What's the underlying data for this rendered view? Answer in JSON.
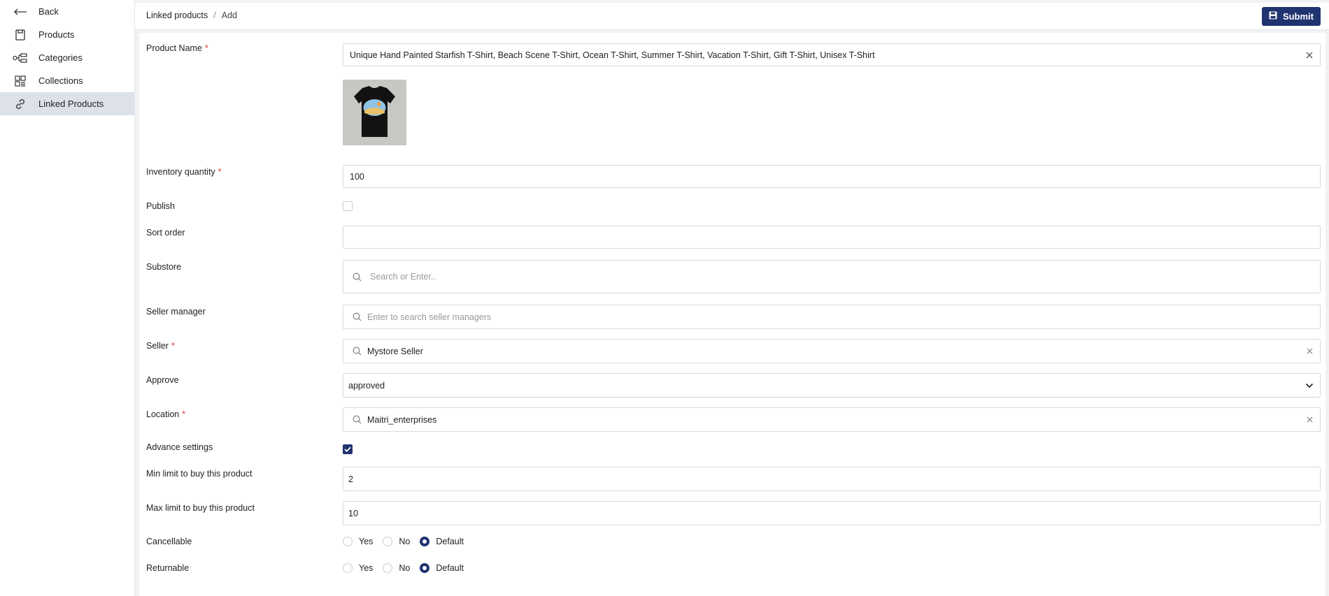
{
  "sidebar": {
    "items": [
      {
        "label": "Back",
        "icon": "arrow-left-icon"
      },
      {
        "label": "Products",
        "icon": "box-icon"
      },
      {
        "label": "Categories",
        "icon": "tree-icon"
      },
      {
        "label": "Collections",
        "icon": "grid-icon"
      },
      {
        "label": "Linked Products",
        "icon": "link-icon",
        "active": true
      }
    ]
  },
  "header": {
    "breadcrumb": [
      "Linked products",
      "Add"
    ],
    "separator": "/",
    "submit_label": "Submit"
  },
  "form": {
    "product_name": {
      "label": "Product Name",
      "value": "Unique Hand Painted Starfish T-Shirt, Beach Scene T-Shirt, Ocean T-Shirt, Summer T-Shirt, Vacation T-Shirt, Gift T-Shirt, Unisex T-Shirt"
    },
    "inventory": {
      "label": "Inventory quantity",
      "value": "100"
    },
    "publish": {
      "label": "Publish",
      "checked": false
    },
    "sort_order": {
      "label": "Sort order",
      "value": ""
    },
    "substore": {
      "label": "Substore",
      "placeholder": "Search or Enter.."
    },
    "seller_manager": {
      "label": "Seller manager",
      "placeholder": "Enter to search seller managers"
    },
    "seller": {
      "label": "Seller",
      "value": "Mystore Seller"
    },
    "approve": {
      "label": "Approve",
      "value": "approved"
    },
    "location": {
      "label": "Location",
      "value": "Maitri_enterprises"
    },
    "advance": {
      "label": "Advance settings",
      "checked": true
    },
    "min_limit": {
      "label": "Min limit to buy this product",
      "value": "2"
    },
    "max_limit": {
      "label": "Max limit to buy this product",
      "value": "10"
    },
    "cancellable": {
      "label": "Cancellable",
      "options": [
        "Yes",
        "No",
        "Default"
      ],
      "selected": "Default"
    },
    "returnable": {
      "label": "Returnable",
      "options": [
        "Yes",
        "No",
        "Default"
      ],
      "selected": "Default"
    }
  },
  "colors": {
    "accent": "#1f3370",
    "required": "#dd3333"
  }
}
